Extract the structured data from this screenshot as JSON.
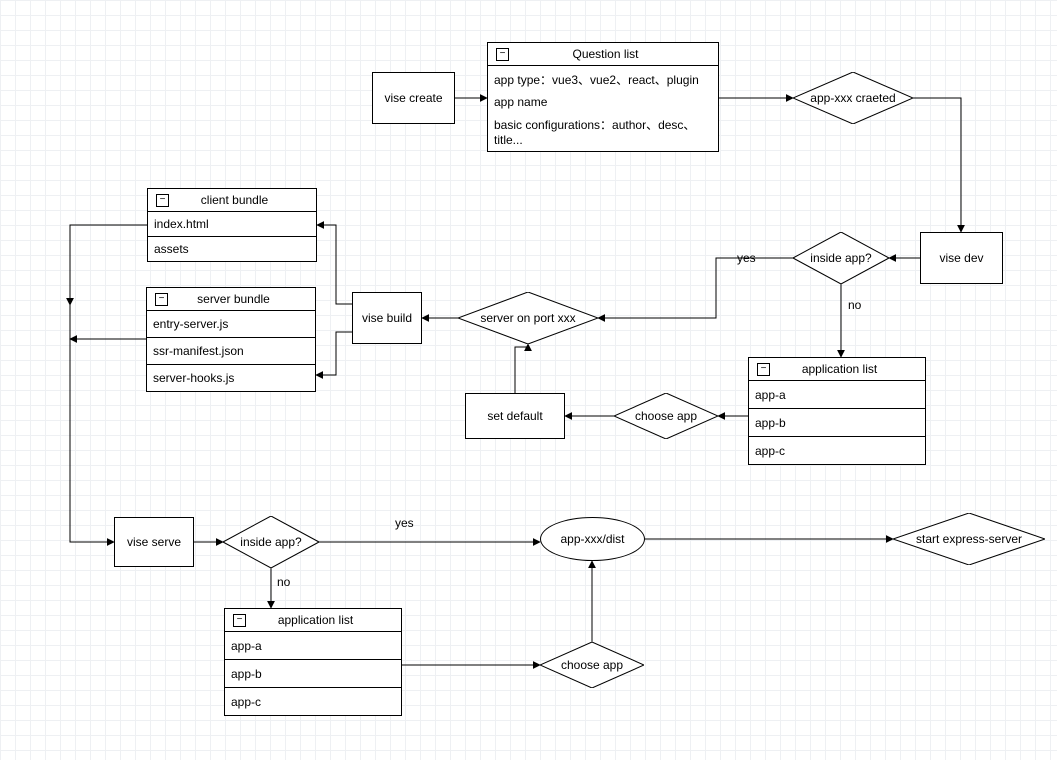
{
  "nodes": {
    "vise_create": "vise create",
    "question_list": {
      "title": "Question list",
      "row1": "app type：vue3、vue2、react、plugin",
      "row2": "app name",
      "row3": "basic configurations：author、desc、title..."
    },
    "app_created": "app-xxx craeted",
    "vise_dev": "vise dev",
    "inside_app_1": "inside app?",
    "inside_app_1_yes": "yes",
    "inside_app_1_no": "no",
    "server_on_port": "server on port xxx",
    "vise_build": "vise build",
    "client_bundle": {
      "title": "client bundle",
      "r1": "index.html",
      "r2": "assets"
    },
    "server_bundle": {
      "title": "server bundle",
      "r1": "entry-server.js",
      "r2": "ssr-manifest.json",
      "r3": "server-hooks.js"
    },
    "app_list_1": {
      "title": "application list",
      "r1": "app-a",
      "r2": "app-b",
      "r3": "app-c"
    },
    "choose_app_1": "choose app",
    "set_default": "set default",
    "vise_serve": "vise serve",
    "inside_app_2": "inside app?",
    "inside_app_2_yes": "yes",
    "inside_app_2_no": "no",
    "app_list_2": {
      "title": "application list",
      "r1": "app-a",
      "r2": "app-b",
      "r3": "app-c"
    },
    "choose_app_2": "choose app",
    "app_dist": "app-xxx/dist",
    "start_express": "start express-server"
  }
}
